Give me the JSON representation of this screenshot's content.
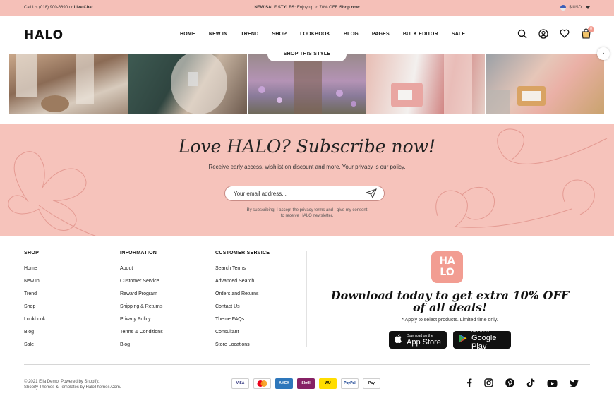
{
  "topbar": {
    "call_prefix": "Call Us (018) 900-6690 or ",
    "live_chat": "Live Chat",
    "sale_label": "NEW SALE STYLES:",
    "sale_text": " Enjoy up to 70% OFF. ",
    "shop_now": "Shop now",
    "currency": "$ USD"
  },
  "header": {
    "logo": "HALO",
    "nav": [
      "HOME",
      "NEW IN",
      "TREND",
      "SHOP",
      "LOOKBOOK",
      "BLOG",
      "PAGES",
      "BULK EDITOR",
      "SALE"
    ],
    "cart_count": "0"
  },
  "instagram": {
    "button": "SHOP THIS STYLE",
    "next": "›"
  },
  "newsletter": {
    "title": "Love HALO? Subscribe now!",
    "subtitle": "Receive early access, wishlist on discount and more. Your privacy is our policy.",
    "placeholder": "Your email address...",
    "disclaimer_line1": "By subscribing, I accept the privacy terms and I give my consent",
    "disclaimer_line2": "to receive HALO newsletter."
  },
  "footer": {
    "shop": {
      "title": "SHOP",
      "items": [
        "Home",
        "New In",
        "Trend",
        "Shop",
        "Lookbook",
        "Blog",
        "Sale"
      ]
    },
    "information": {
      "title": "INFORMATION",
      "items": [
        "About",
        "Customer Service",
        "Reward Program",
        "Shipping & Returns",
        "Privacy Policy",
        "Terms & Conditions",
        "Blog"
      ]
    },
    "customer_service": {
      "title": "CUSTOMER SERVICE",
      "items": [
        "Search Terms",
        "Advanced Search",
        "Orders and Returns",
        "Contact Us",
        "Theme FAQs",
        "Consultant",
        "Store Locations"
      ]
    },
    "app": {
      "logo_top": "HA",
      "logo_bottom": "LO",
      "promo": "Download today to get extra 10% OFF of all deals!",
      "note": "* Apply to select products. Limited time only.",
      "appstore_small": "Download on the",
      "appstore_big": "App Store",
      "googleplay_small": "GET IT ON",
      "googleplay_big": "Google Play"
    },
    "copyright_line1": "© 2021 Ella Demo. Powered by Shopify.",
    "copyright_line2": "Shopify Themes & Templates by HaloThemes.Com.",
    "payments": [
      "VISA",
      "MC",
      "AMEX",
      "Skrill",
      "WU",
      "PayPal",
      "Pay"
    ]
  },
  "colors": {
    "topbar_bg": "#f5c0b8",
    "newsletter_bg": "#f6c3bb",
    "accent": "#f29d92"
  }
}
